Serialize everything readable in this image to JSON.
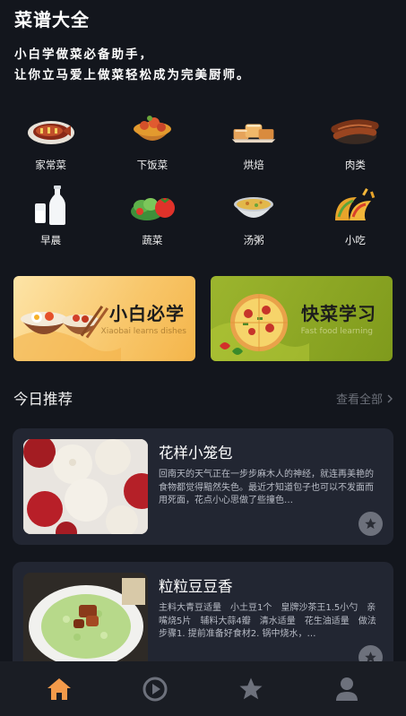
{
  "app": {
    "title": "菜谱大全"
  },
  "slogan": {
    "line1": "小白学做菜必备助手，",
    "line2": "让你立马爱上做菜轻松成为完美厨师。"
  },
  "categories": [
    {
      "label": "家常菜",
      "icon": "fish-dish-icon"
    },
    {
      "label": "下饭菜",
      "icon": "stew-bowl-icon"
    },
    {
      "label": "烘焙",
      "icon": "baked-pastry-icon"
    },
    {
      "label": "肉类",
      "icon": "sausage-icon"
    },
    {
      "label": "早晨",
      "icon": "milk-bottle-icon"
    },
    {
      "label": "蔬菜",
      "icon": "salad-icon"
    },
    {
      "label": "汤粥",
      "icon": "soup-bowl-icon"
    },
    {
      "label": "小吃",
      "icon": "taco-icon"
    }
  ],
  "banners": [
    {
      "title": "小白必学",
      "subtitle": "Xiaobai learns dishes"
    },
    {
      "title": "快菜学习",
      "subtitle": "Fast food learning"
    }
  ],
  "recommend": {
    "title": "今日推荐",
    "view_all": "查看全部",
    "items": [
      {
        "title": "花样小笼包",
        "desc": "回南天的天气正在一步步麻木人的神经，就连再美艳的食物都觉得黯然失色。最近才知道包子也可以不发面而用死面，花点小心思做了些撞色…"
      },
      {
        "title": "粒粒豆豆香",
        "desc": "主料大青豆适量　小土豆1个　皇牌沙茶王1.5小勺　亲嘴烧5片　辅料大蒜4瓣　清水适量　花生油适量　做法步骤1. 提前准备好食材2. 锅中烧水，…"
      }
    ]
  },
  "tabbar": [
    {
      "name": "home",
      "icon": "home-icon",
      "active": true
    },
    {
      "name": "video",
      "icon": "play-icon",
      "active": false
    },
    {
      "name": "favorites",
      "icon": "star-icon",
      "active": false
    },
    {
      "name": "profile",
      "icon": "user-icon",
      "active": false
    }
  ],
  "colors": {
    "background": "#13161d",
    "card": "#222632",
    "accent": "#f39a4a",
    "muted": "#6b6f78"
  }
}
